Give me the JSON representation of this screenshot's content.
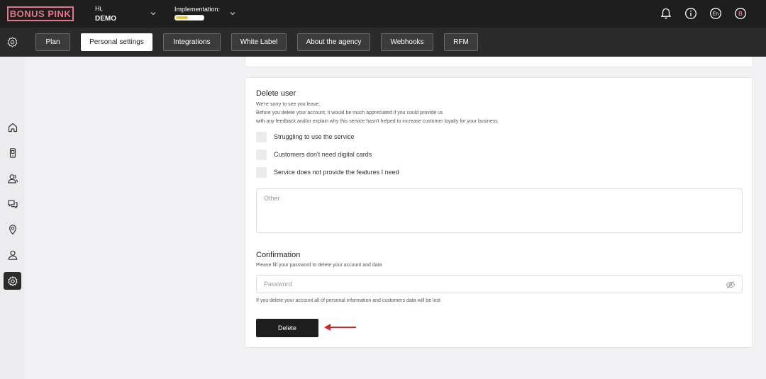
{
  "app": {
    "logo_text": "BONUS PINK"
  },
  "header": {
    "greeting": "Hi,",
    "user_name": "DEMO",
    "implementation_label": "Implementation:",
    "implementation_progress": 0.45,
    "language": "En",
    "avatar_letter": "B"
  },
  "tabs": [
    {
      "label": "Plan"
    },
    {
      "label": "Personal settings",
      "active": true
    },
    {
      "label": "Integrations"
    },
    {
      "label": "White Label"
    },
    {
      "label": "About the agency"
    },
    {
      "label": "Webhooks"
    },
    {
      "label": "RFM"
    }
  ],
  "sidebar": {
    "items": [
      "home-icon",
      "phone-icon",
      "users-icon",
      "chat-icon",
      "location-pin-icon",
      "user-icon",
      "gear-icon"
    ],
    "active_index": 6
  },
  "delete_user": {
    "title": "Delete user",
    "line1": "We're sorry to see you leave.",
    "line2": "Before you delete your account, it would be much appreciated if you could provide us",
    "line3": "with any feedback and/or explain why this service hasn't helped to increase customer loyalty for your business.",
    "reasons": [
      "Struggling to use the service",
      "Customers don't need digital cards",
      "Service does not provide the features I need"
    ],
    "other_placeholder": "Other"
  },
  "confirmation": {
    "title": "Confirmation",
    "subtitle": "Please fill your password to delete your account and data",
    "password_placeholder": "Password",
    "warning": "If you delete your account all of personal information and customers data will be lost",
    "delete_label": "Delete"
  },
  "colors": {
    "brand": "#e8738a",
    "progress": "#e9c53a",
    "arrow": "#e02020",
    "dark": "#1e1e1e"
  }
}
